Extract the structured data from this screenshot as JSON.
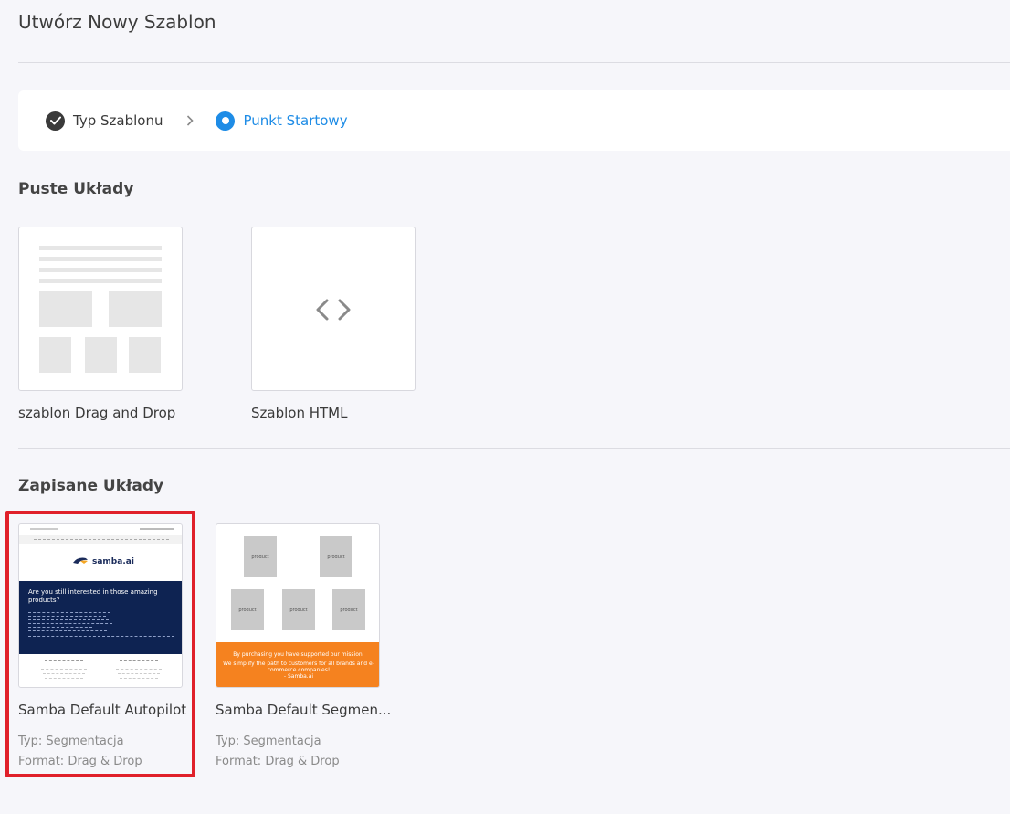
{
  "header": {
    "title": "Utwórz Nowy Szablon"
  },
  "stepper": {
    "steps": [
      {
        "label": "Typ Szablonu",
        "state": "done"
      },
      {
        "label": "Punkt Startowy",
        "state": "active"
      }
    ]
  },
  "blank_layouts": {
    "title": "Puste Układy",
    "items": [
      {
        "label": "szablon Drag and Drop"
      },
      {
        "label": "Szablon HTML"
      }
    ]
  },
  "saved_layouts": {
    "title": "Zapisane Układy",
    "items": [
      {
        "label": "Samba Default Autopilot",
        "type": "Typ: Segmentacja",
        "format": "Format: Drag & Drop",
        "preview": {
          "brand": "samba.ai",
          "headline": "Are you still interested in those amazing products?"
        }
      },
      {
        "label": "Samba Default Segmen...",
        "type": "Typ: Segmentacja",
        "format": "Format: Drag & Drop",
        "preview": {
          "product_label": "product",
          "footer_line1": "By purchasing you have supported our mission:",
          "footer_line2": "We simplify the path to customers for all brands and e-commerce companies!",
          "footer_line3": "- Samba.ai"
        }
      }
    ]
  },
  "colors": {
    "accent": "#1e8ce6",
    "highlight": "#e0202a",
    "navy": "#0e2352",
    "orange": "#f5821f"
  }
}
